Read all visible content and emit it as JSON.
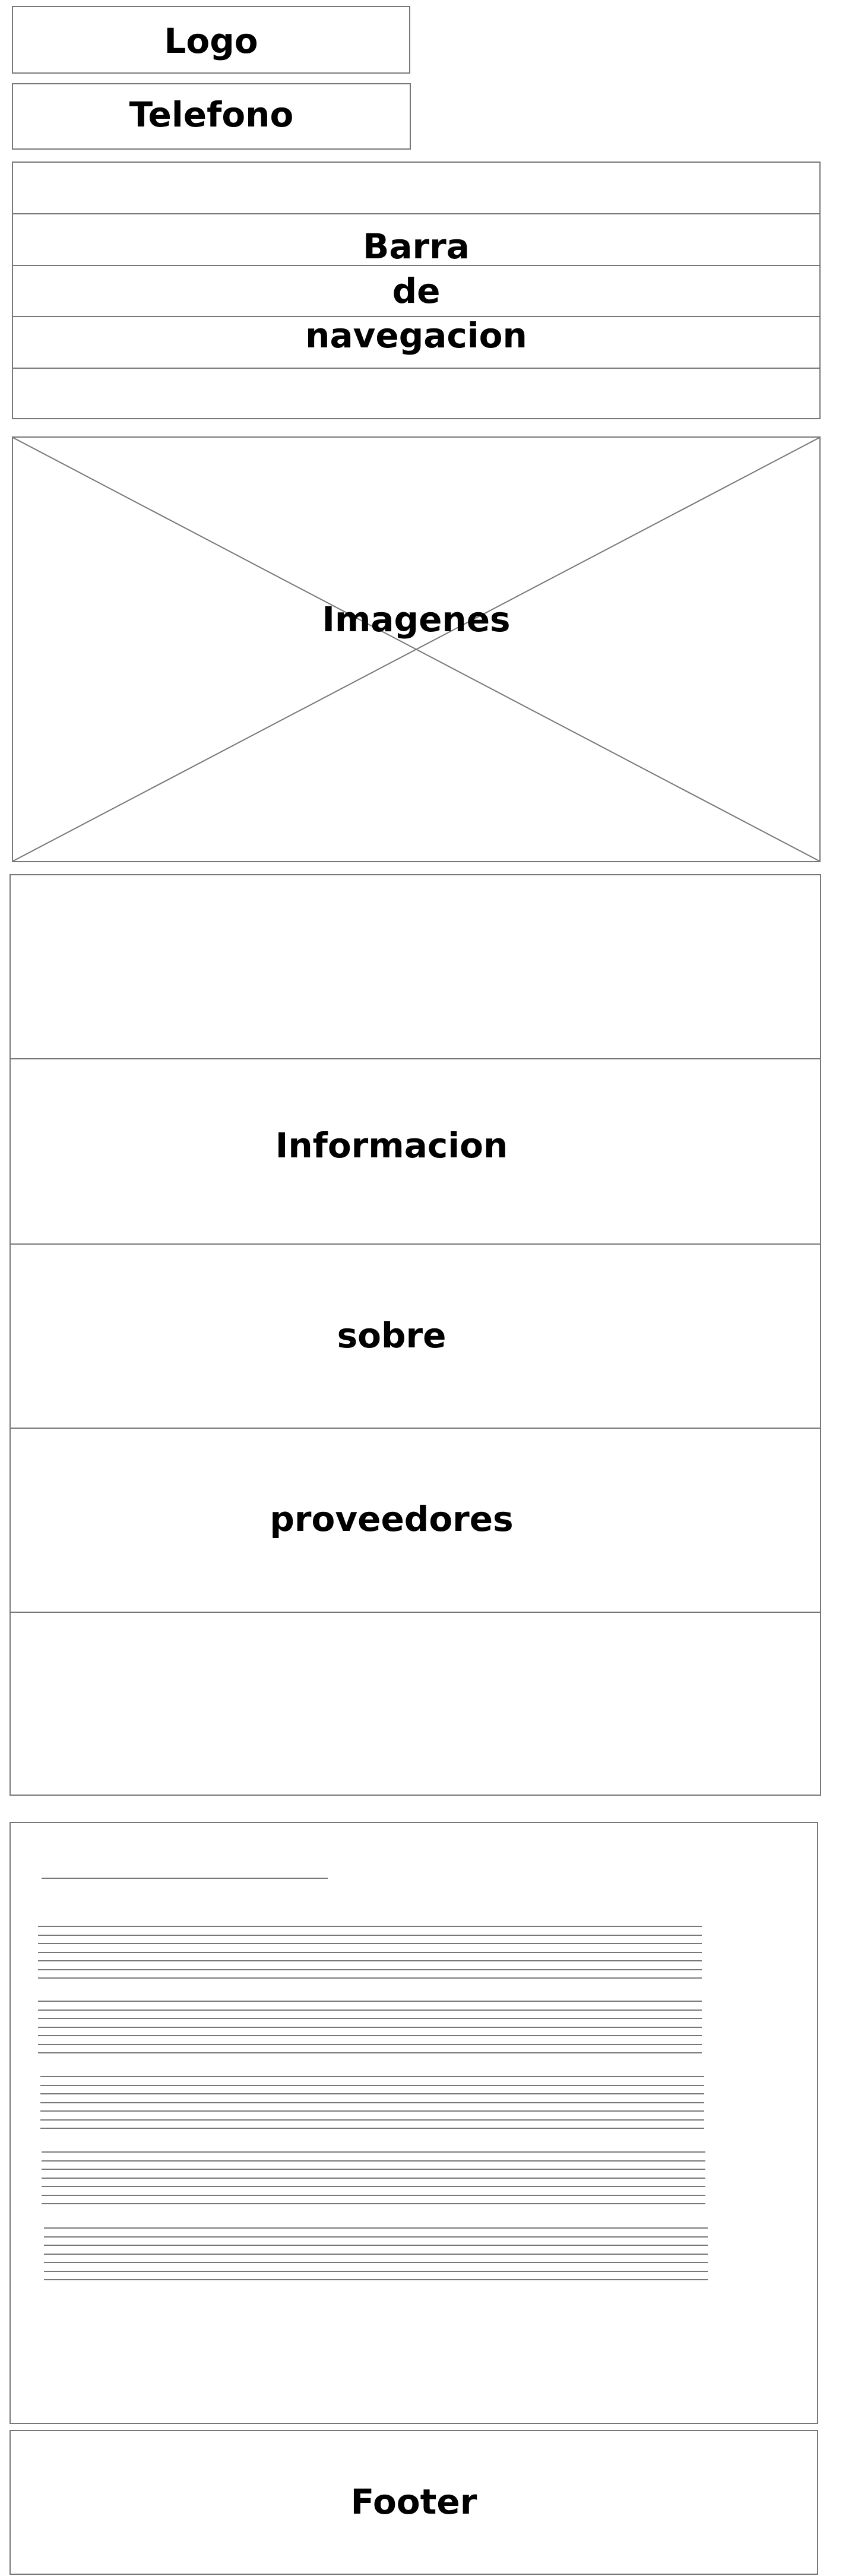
{
  "header": {
    "logo_label": "Logo",
    "phone_label": "Telefono"
  },
  "nav": {
    "label_lines": [
      "Barra",
      "de",
      "navegacion"
    ]
  },
  "hero": {
    "label": "Imagenes"
  },
  "providers": {
    "label_lines": [
      "Informacion",
      "sobre",
      "proveedores"
    ]
  },
  "footer": {
    "label": "Footer"
  },
  "colors": {
    "border": "#777777",
    "text": "#000000",
    "background": "#ffffff"
  }
}
